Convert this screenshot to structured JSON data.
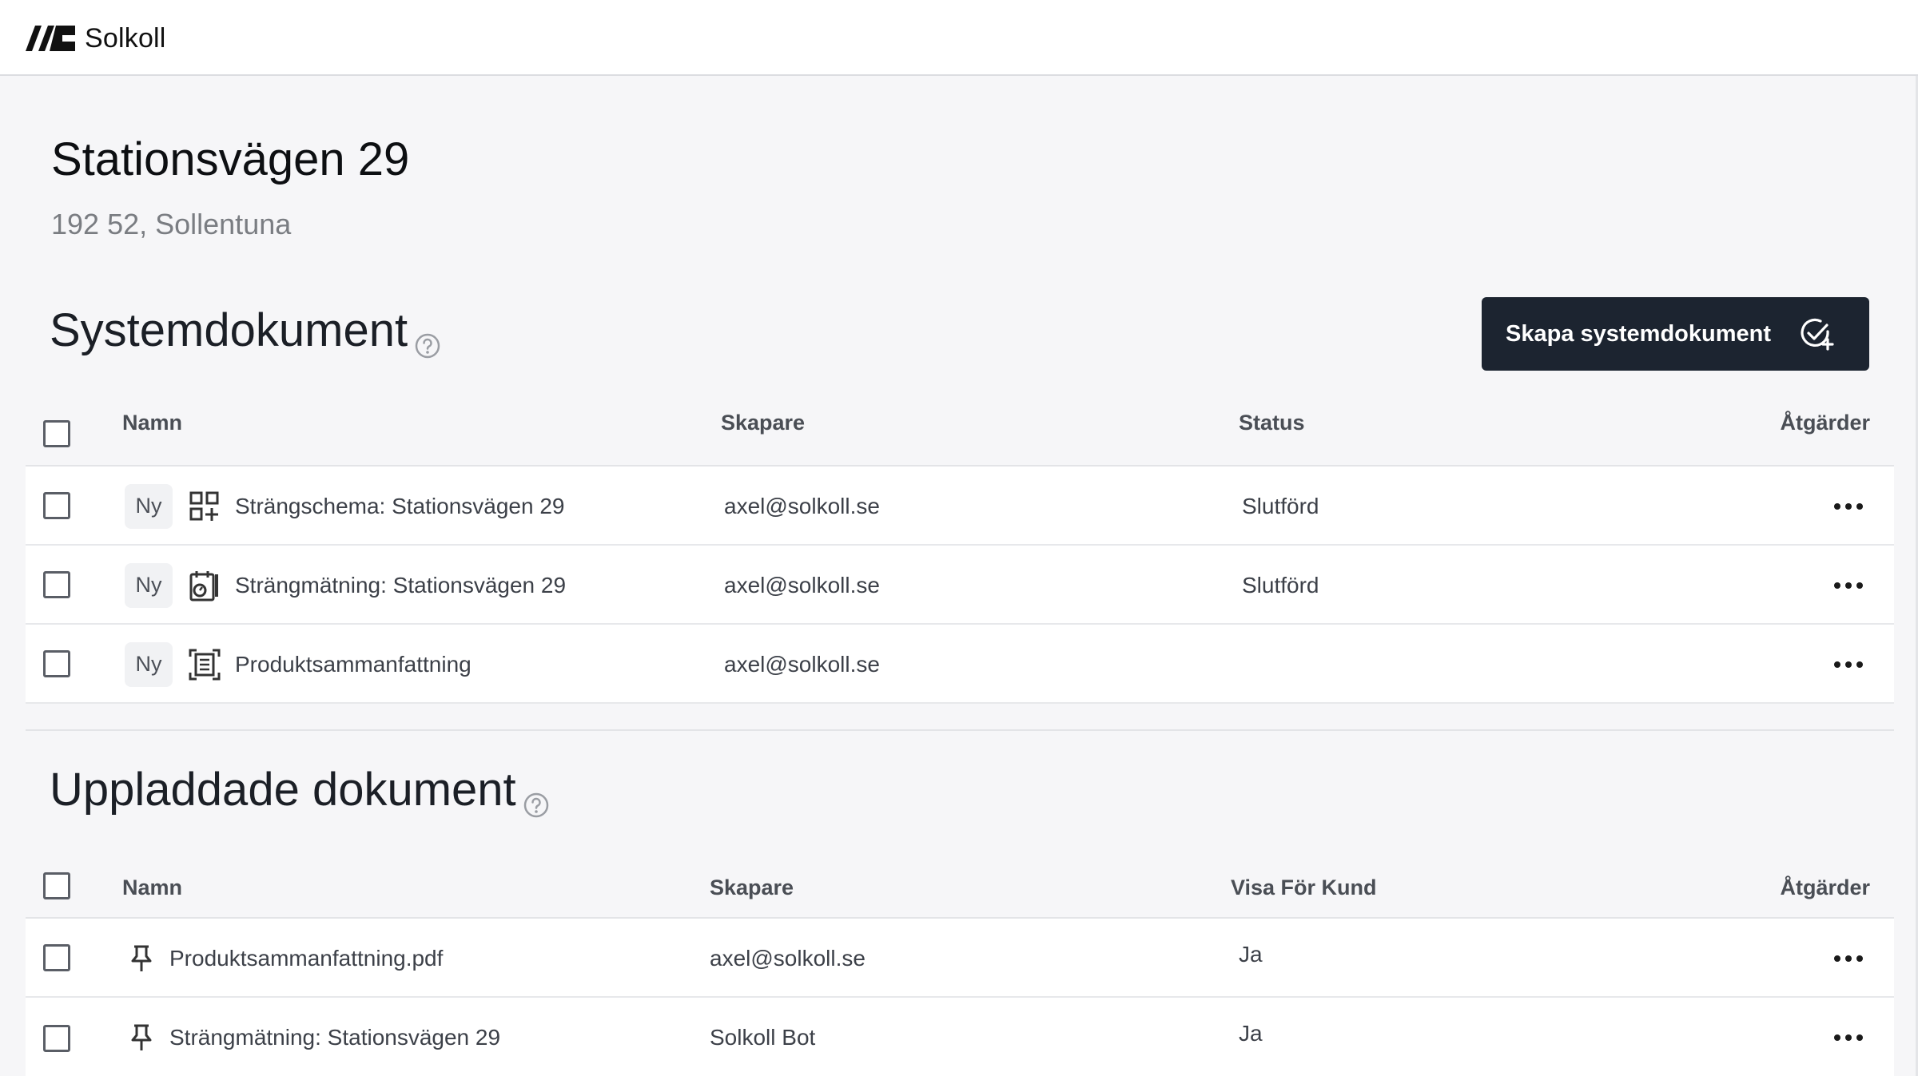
{
  "app": {
    "name": "Solkoll"
  },
  "page": {
    "title": "Stationsvägen 29",
    "subtitle": "192 52, Sollentuna"
  },
  "system": {
    "title": "Systemdokument",
    "create_button": "Skapa systemdokument",
    "columns": {
      "name": "Namn",
      "creator": "Skapare",
      "status": "Status",
      "actions": "Åtgärder"
    },
    "rows": [
      {
        "badge": "Ny",
        "icon": "string-schema-icon",
        "name": "Strängschema: Stationsvägen 29",
        "creator": "axel@solkoll.se",
        "status": "Slutförd"
      },
      {
        "badge": "Ny",
        "icon": "string-measurement-icon",
        "name": "Strängmätning: Stationsvägen 29",
        "creator": "axel@solkoll.se",
        "status": "Slutförd"
      },
      {
        "badge": "Ny",
        "icon": "document-scan-icon",
        "name": "Produktsammanfattning",
        "creator": "axel@solkoll.se",
        "status": ""
      }
    ]
  },
  "uploaded": {
    "title": "Uppladdade dokument",
    "columns": {
      "name": "Namn",
      "creator": "Skapare",
      "visible": "Visa För Kund",
      "actions": "Åtgärder"
    },
    "rows": [
      {
        "icon": "pin-icon",
        "name": "Produktsammanfattning.pdf",
        "creator": "axel@solkoll.se",
        "visible": "Ja"
      },
      {
        "icon": "pin-icon",
        "name": "Strängmätning: Stationsvägen 29",
        "creator": "Solkoll Bot",
        "visible": "Ja"
      }
    ]
  }
}
